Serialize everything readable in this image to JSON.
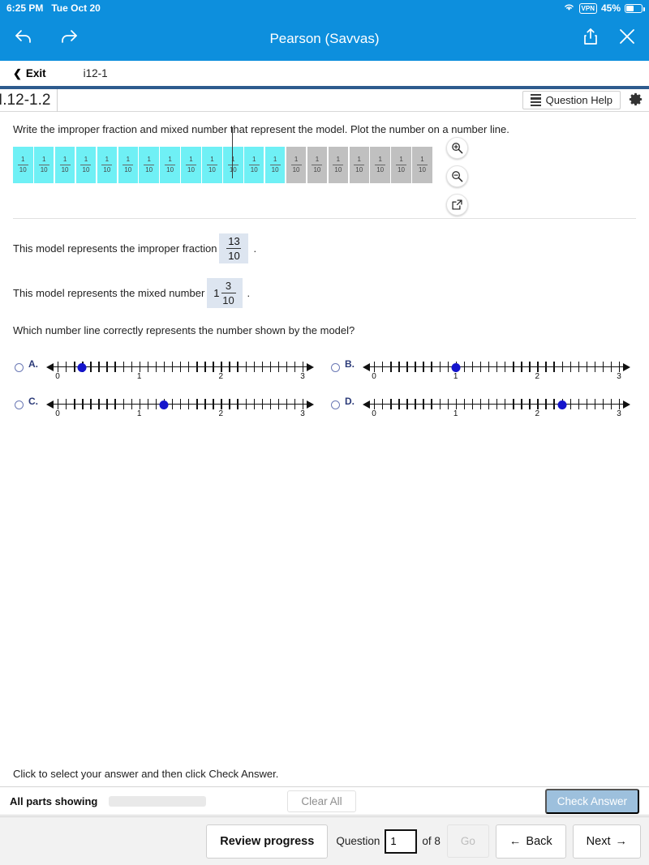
{
  "status_bar": {
    "time": "6:25 PM",
    "date": "Tue Oct 20",
    "wifi_icon": "wifi-icon",
    "vpn_label": "VPN",
    "battery_percent": "45%",
    "battery_level": 45
  },
  "app_toolbar": {
    "back_icon": "back-arrow-icon",
    "forward_icon": "forward-arrow-icon",
    "title": "Pearson (Savvas)",
    "share_icon": "share-icon",
    "close_icon": "close-icon",
    "background_color": "#0d8fdd"
  },
  "exit_bar": {
    "exit_label": "Exit",
    "chevron_icon": "chevron-left-icon",
    "exercise_id": "i12-1"
  },
  "question_header": {
    "title": "I.12-1.2",
    "question_help_label": "Question Help",
    "list_icon": "list-icon",
    "gear_icon": "gear-icon"
  },
  "instruction": "Write the improper fraction and mixed number that represent the model. Plot the number on a number line.",
  "model": {
    "total_tiles": 20,
    "filled_tiles": 13,
    "tile_numerator": "1",
    "tile_denominator": "10",
    "whole_divider_after": 10,
    "filled_color": "#6ff0f5",
    "empty_color": "#c0c0c0",
    "tools": [
      {
        "name": "zoom-in-icon",
        "label": "Zoom In"
      },
      {
        "name": "zoom-out-icon",
        "label": "Zoom Out"
      },
      {
        "name": "open-external-icon",
        "label": "Open in new window"
      }
    ]
  },
  "statements": {
    "improper_prefix": "This model represents the improper fraction",
    "improper_numerator": "13",
    "improper_denominator": "10",
    "mixed_prefix": "This model represents the mixed number",
    "mixed_whole": "1",
    "mixed_numerator": "3",
    "mixed_denominator": "10",
    "period": "."
  },
  "subquestion": "Which number line correctly represents the number shown by the model?",
  "choices": [
    {
      "letter": "A.",
      "selected": false,
      "dot_value": 0.3,
      "labels": [
        "0",
        "1",
        "2",
        "3"
      ],
      "min": 0,
      "max": 3,
      "tick_step": 0.1
    },
    {
      "letter": "B.",
      "selected": false,
      "dot_value": 1.0,
      "labels": [
        "0",
        "1",
        "2",
        "3"
      ],
      "min": 0,
      "max": 3,
      "tick_step": 0.1
    },
    {
      "letter": "C.",
      "selected": false,
      "dot_value": 1.3,
      "labels": [
        "0",
        "1",
        "2",
        "3"
      ],
      "min": 0,
      "max": 3,
      "tick_step": 0.1
    },
    {
      "letter": "D.",
      "selected": false,
      "dot_value": 2.3,
      "labels": [
        "0",
        "1",
        "2",
        "3"
      ],
      "min": 0,
      "max": 3,
      "tick_step": 0.1
    }
  ],
  "footer": {
    "hint": "Click to select your answer and then click Check Answer.",
    "parts_label": "All parts showing",
    "progress_percent": 100,
    "progress_color": "#4a7db5",
    "clear_all_label": "Clear All",
    "check_answer_label": "Check Answer",
    "check_answer_color": "#9dc0dd"
  },
  "navbar": {
    "review_progress_label": "Review progress",
    "question_label": "Question",
    "question_number": "1",
    "of_label": "of 8",
    "go_label": "Go",
    "back_label": "Back",
    "back_icon": "arrow-left-icon",
    "next_label": "Next",
    "next_icon": "arrow-right-icon"
  }
}
